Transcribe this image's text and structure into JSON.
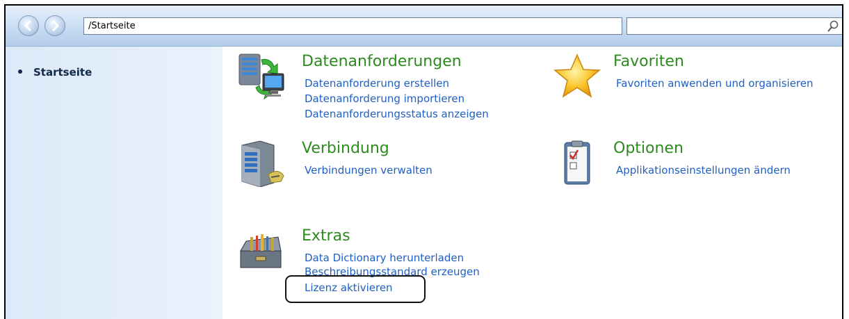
{
  "toolbar": {
    "back_icon": "back-arrow-icon",
    "forward_icon": "forward-arrow-icon",
    "address": "/Startseite",
    "search_value": "",
    "search_icon": "search-icon"
  },
  "sidebar": {
    "items": [
      {
        "label": "Startseite"
      }
    ]
  },
  "main": {
    "groups": [
      {
        "title": "Datenanforderungen",
        "icon": "data-sync-computer-icon",
        "links": [
          "Datenanforderung erstellen",
          "Datenanforderung importieren",
          "Datenanforderungsstatus anzeigen"
        ]
      },
      {
        "title": "Favoriten",
        "icon": "star-icon",
        "links": [
          "Favoriten anwenden und organisieren"
        ]
      },
      {
        "title": "Verbindung",
        "icon": "server-connection-icon",
        "links": [
          "Verbindungen verwalten"
        ]
      },
      {
        "title": "Optionen",
        "icon": "clipboard-checklist-icon",
        "links": [
          "Applikationseinstellungen ändern"
        ]
      },
      {
        "title": "Extras",
        "icon": "toolbox-icon",
        "links": [
          "Data Dictionary herunterladen",
          "Beschreibungsstandard erzeugen",
          "Lizenz aktivieren"
        ]
      }
    ]
  },
  "colors": {
    "title_green": "#2d8a1f",
    "link_blue": "#1f5fc4",
    "sidebar_bg": "#dce9f8"
  }
}
